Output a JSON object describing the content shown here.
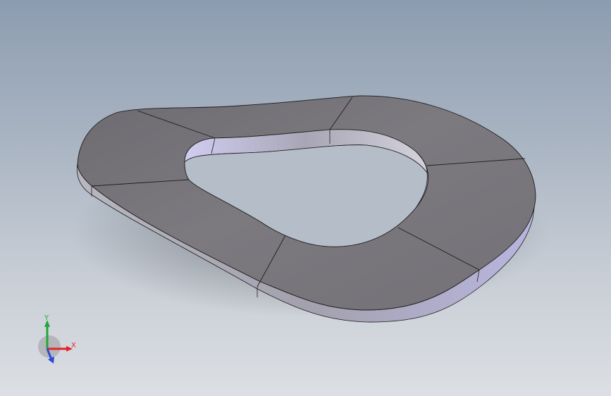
{
  "viewport": {
    "model": "wave-spring-washer",
    "colors": {
      "face_top": "#7a787c",
      "face_dark": "#6e6c70",
      "side_outer": "#a9a7b4",
      "side_inner": "#c6c3e6",
      "edge_line": "#1c1c1c"
    }
  },
  "triad": {
    "x_label": "X",
    "y_label": "Y",
    "z_label": "",
    "colors": {
      "x": "#e0262b",
      "y": "#21a83a",
      "z": "#2b4bd6"
    }
  }
}
